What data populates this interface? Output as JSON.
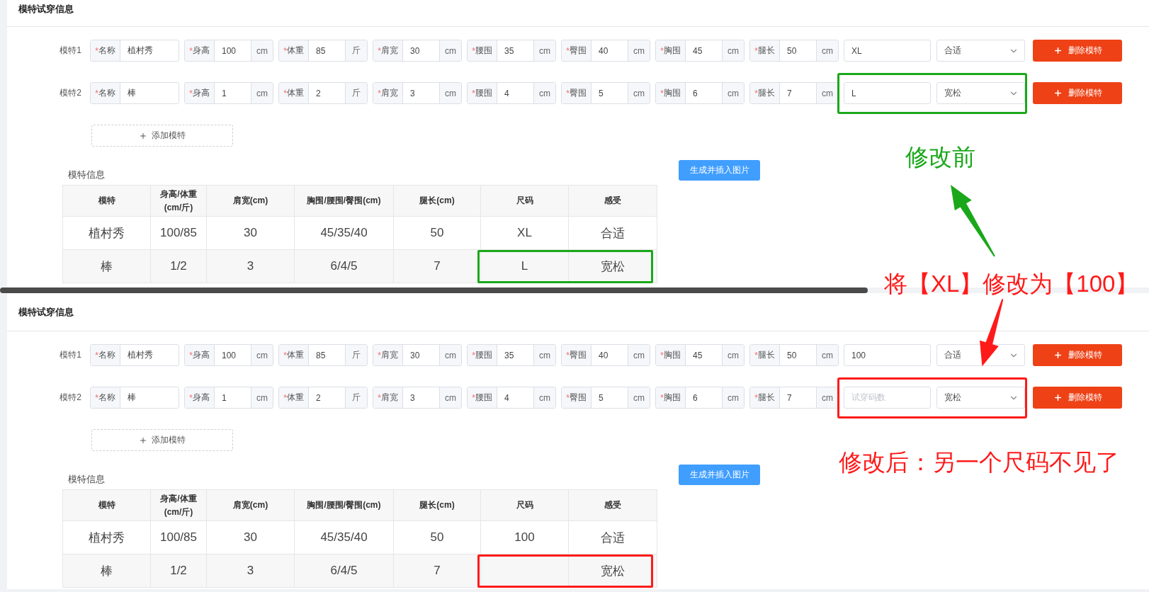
{
  "panels": [
    {
      "title": "模特试穿信息",
      "cut": true,
      "models": [
        {
          "label": "模特1",
          "fields": [
            {
              "mark": "*",
              "label": "名称",
              "value": "植村秀"
            },
            {
              "mark": "*",
              "label": "身高",
              "value": "100",
              "unit": "cm"
            },
            {
              "mark": "*",
              "label": "体重",
              "value": "85",
              "unit": "斤"
            },
            {
              "mark": "*",
              "label": "肩宽",
              "value": "30",
              "unit": "cm"
            },
            {
              "mark": "*",
              "label": "腰围",
              "value": "35",
              "unit": "cm"
            },
            {
              "mark": "*",
              "label": "臀围",
              "value": "40",
              "unit": "cm"
            },
            {
              "mark": "*",
              "label": "胸围",
              "value": "45",
              "unit": "cm"
            },
            {
              "mark": "*",
              "label": "腿长",
              "value": "50",
              "unit": "cm"
            }
          ],
          "size": {
            "value": "XL"
          },
          "feel": "合适",
          "delete_button": "删除模特"
        },
        {
          "label": "模特2",
          "fields": [
            {
              "mark": "*",
              "label": "名称",
              "value": "棒"
            },
            {
              "mark": "*",
              "label": "身高",
              "value": "1",
              "unit": "cm"
            },
            {
              "mark": "*",
              "label": "体重",
              "value": "2",
              "unit": "斤"
            },
            {
              "mark": "*",
              "label": "肩宽",
              "value": "3",
              "unit": "cm"
            },
            {
              "mark": "*",
              "label": "腰围",
              "value": "4",
              "unit": "cm"
            },
            {
              "mark": "*",
              "label": "臀围",
              "value": "5",
              "unit": "cm"
            },
            {
              "mark": "*",
              "label": "胸围",
              "value": "6",
              "unit": "cm"
            },
            {
              "mark": "*",
              "label": "腿长",
              "value": "7",
              "unit": "cm"
            }
          ],
          "size": {
            "value": "L"
          },
          "feel": "宽松",
          "delete_button": "删除模特",
          "color": "#1aa81a"
        }
      ],
      "add_button": "添加模特",
      "generate_button": "生成并插入图片",
      "table": {
        "caption": "模特信息",
        "columns": [
          "模特",
          "身高/体重\n(cm/斤)",
          "肩宽(cm)",
          "胸围/腰围/臀围(cm)",
          "腿长(cm)",
          "尺码",
          "感受"
        ],
        "rows": [
          {
            "cells": [
              "植村秀",
              "100/85",
              "30",
              "45/35/40",
              "50",
              "XL",
              "合适"
            ]
          },
          {
            "cells": [
              "棒",
              "1/2",
              "3",
              "6/4/5",
              "7",
              "L",
              "宽松"
            ],
            "color": "#1aa81a"
          }
        ]
      }
    },
    {
      "title": "模特试穿信息",
      "cut": false,
      "models": [
        {
          "label": "模特1",
          "fields": [
            {
              "mark": "*",
              "label": "名称",
              "value": "植村秀"
            },
            {
              "mark": "*",
              "label": "身高",
              "value": "100",
              "unit": "cm"
            },
            {
              "mark": "*",
              "label": "体重",
              "value": "85",
              "unit": "斤"
            },
            {
              "mark": "*",
              "label": "肩宽",
              "value": "30",
              "unit": "cm"
            },
            {
              "mark": "*",
              "label": "腰围",
              "value": "35",
              "unit": "cm"
            },
            {
              "mark": "*",
              "label": "臀围",
              "value": "40",
              "unit": "cm"
            },
            {
              "mark": "*",
              "label": "胸围",
              "value": "45",
              "unit": "cm"
            },
            {
              "mark": "*",
              "label": "腿长",
              "value": "50",
              "unit": "cm"
            }
          ],
          "size": {
            "value": "100"
          },
          "feel": "合适",
          "delete_button": "删除模特"
        },
        {
          "label": "模特2",
          "fields": [
            {
              "mark": "*",
              "label": "名称",
              "value": "棒"
            },
            {
              "mark": "*",
              "label": "身高",
              "value": "1",
              "unit": "cm"
            },
            {
              "mark": "*",
              "label": "体重",
              "value": "2",
              "unit": "斤"
            },
            {
              "mark": "*",
              "label": "肩宽",
              "value": "3",
              "unit": "cm"
            },
            {
              "mark": "*",
              "label": "腰围",
              "value": "4",
              "unit": "cm"
            },
            {
              "mark": "*",
              "label": "臀围",
              "value": "5",
              "unit": "cm"
            },
            {
              "mark": "*",
              "label": "胸围",
              "value": "6",
              "unit": "cm"
            },
            {
              "mark": "*",
              "label": "腿长",
              "value": "7",
              "unit": "cm"
            }
          ],
          "size": {
            "placeholder": "试穿码数"
          },
          "feel": "宽松",
          "delete_button": "删除模特",
          "color": "#ff1a1a"
        }
      ],
      "add_button": "添加模特",
      "generate_button": "生成并插入图片",
      "table": {
        "caption": "模特信息",
        "columns": [
          "模特",
          "身高/体重\n(cm/斤)",
          "肩宽(cm)",
          "胸围/腰围/臀围(cm)",
          "腿长(cm)",
          "尺码",
          "感受"
        ],
        "rows": [
          {
            "cells": [
              "植村秀",
              "100/85",
              "30",
              "45/35/40",
              "50",
              "100",
              "合适"
            ]
          },
          {
            "cells": [
              "棒",
              "1/2",
              "3",
              "6/4/5",
              "7",
              "",
              "宽松"
            ],
            "color": "#ff1a1a"
          }
        ]
      }
    }
  ],
  "annotations": [
    {
      "text": "修改前",
      "color": "#1aa81a",
      "arrow": true
    },
    {
      "text": "将【XL】修改为【100】",
      "color": "#ff1a1a",
      "arrow": true
    },
    {
      "text": "修改后：另一个尺码不见了",
      "color": "#ff1a1a"
    }
  ]
}
